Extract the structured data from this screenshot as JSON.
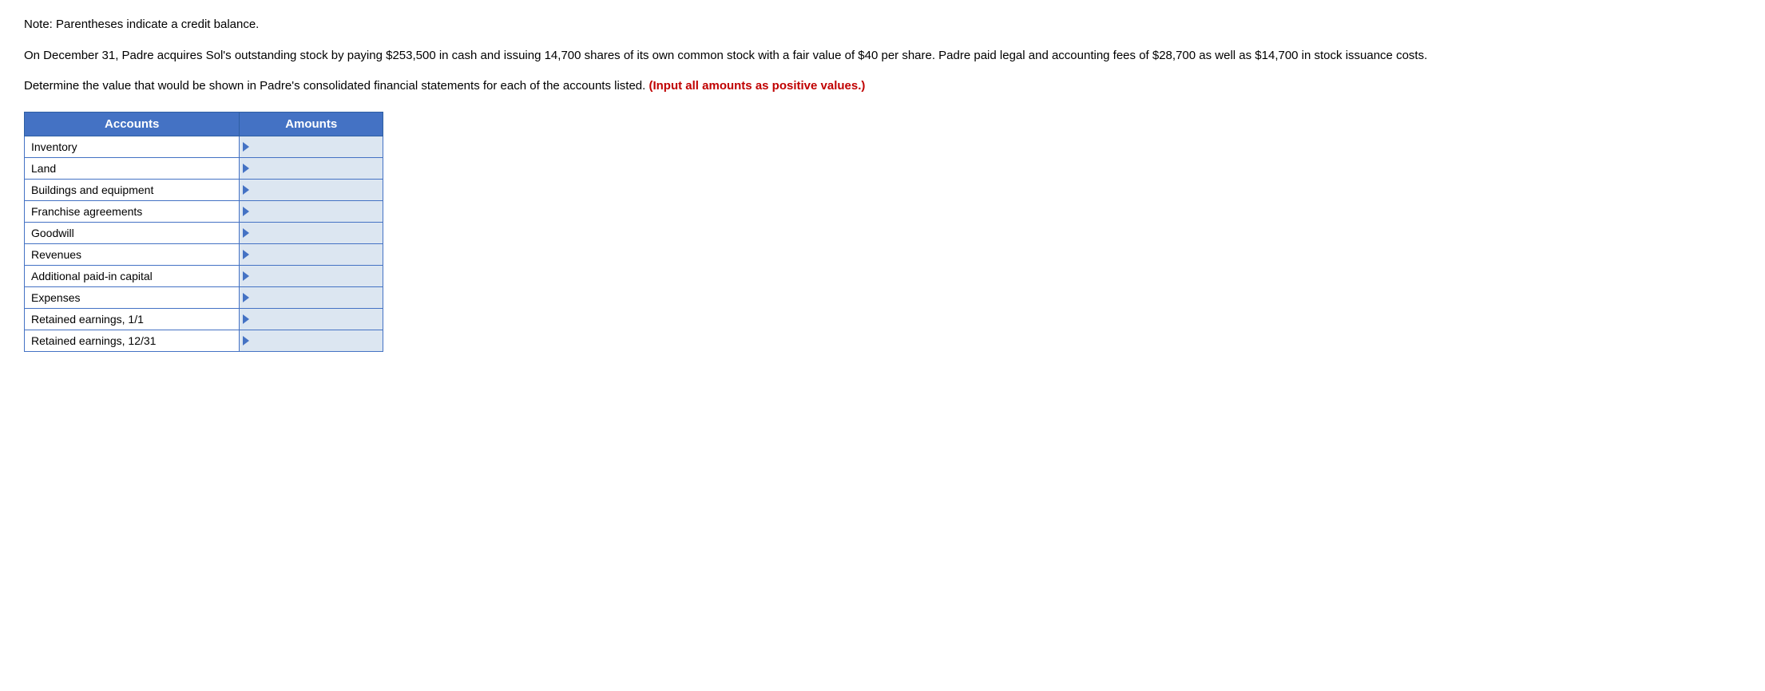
{
  "note": {
    "text": "Note: Parentheses indicate a credit balance."
  },
  "paragraph1": {
    "text": "On December 31, Padre acquires Sol's outstanding stock by paying $253,500 in cash and issuing 14,700 shares of its own common stock with a fair value of $40 per share. Padre paid legal and accounting fees of $28,700 as well as $14,700 in stock issuance costs."
  },
  "paragraph2": {
    "before": "Determine the value that would be shown in Padre's consolidated financial statements for each of the accounts listed. ",
    "bold_red": "(Input all amounts as positive values.)"
  },
  "table": {
    "headers": [
      "Accounts",
      "Amounts"
    ],
    "rows": [
      {
        "account": "Inventory",
        "amount": ""
      },
      {
        "account": "Land",
        "amount": ""
      },
      {
        "account": "Buildings and equipment",
        "amount": ""
      },
      {
        "account": "Franchise agreements",
        "amount": ""
      },
      {
        "account": "Goodwill",
        "amount": ""
      },
      {
        "account": "Revenues",
        "amount": ""
      },
      {
        "account": "Additional paid-in capital",
        "amount": ""
      },
      {
        "account": "Expenses",
        "amount": ""
      },
      {
        "account": "Retained earnings, 1/1",
        "amount": ""
      },
      {
        "account": "Retained earnings, 12/31",
        "amount": ""
      }
    ]
  }
}
